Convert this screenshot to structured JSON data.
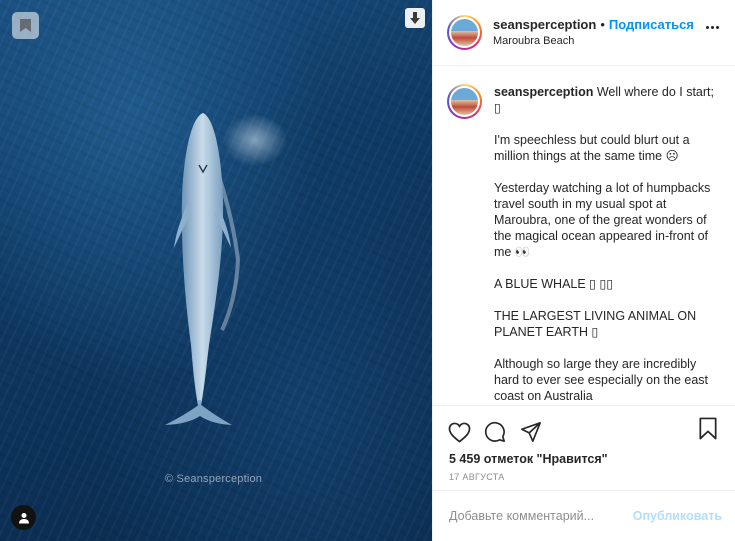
{
  "photo": {
    "watermark": "© Seansperception",
    "icons": {
      "save": "bookmark-icon",
      "download": "download-arrow-icon",
      "user_tags": "person-icon"
    }
  },
  "post": {
    "username": "seansperception",
    "separator": "•",
    "follow_label": "Подписаться",
    "location": "Maroubra Beach",
    "more_icon": "more-horizontal-icon"
  },
  "caption": {
    "username": "seansperception",
    "first_line": " Well where do I start; ▯",
    "paragraphs": [
      "I'm speechless but could blurt out a million things at the same time ☹",
      "Yesterday watching a lot of humpbacks travel south in my usual spot at Maroubra, one of the great wonders of the magical ocean appeared in-front of me 👀",
      "A BLUE WHALE ▯ ▯▯",
      "THE LARGEST LIVING ANIMAL ON PLANET EARTH ▯",
      "Although so large they are incredibly hard to ever see especially on the east coast on Australia"
    ]
  },
  "actions": {
    "icons": [
      "heart-icon",
      "comment-icon",
      "share-icon",
      "bookmark-icon"
    ],
    "likes_text": "5 459 отметок \"Нравится\"",
    "date_text": "17 АВГУСТА"
  },
  "comment": {
    "placeholder": "Добавьте комментарий...",
    "post_label": "Опубликовать"
  },
  "colors": {
    "accent": "#0095f6",
    "post_disabled": "#b2dffc",
    "ocean_dark": "#0a2a4c",
    "ocean_mid": "#1a4f80"
  }
}
